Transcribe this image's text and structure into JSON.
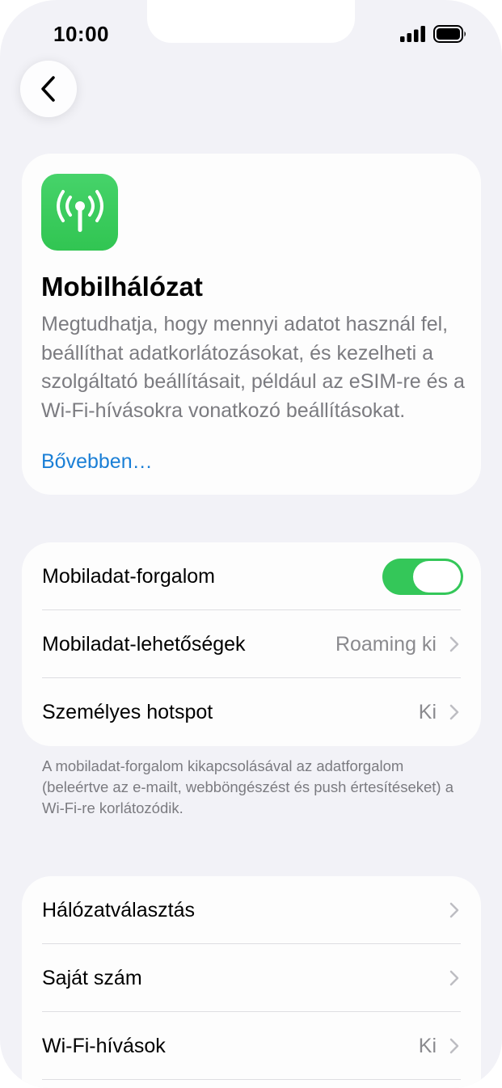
{
  "status_bar": {
    "time": "10:00",
    "signal_icon": "signal-bars-icon",
    "battery_icon": "battery-full-icon"
  },
  "nav": {
    "back_icon": "chevron-left-icon"
  },
  "intro": {
    "icon": "antenna-icon",
    "icon_color": "#34c759",
    "title": "Mobilhálózat",
    "description": "Megtudhatja, hogy mennyi adatot használ fel, beállíthat adatkorlátozásokat, és kezelheti a szolgáltató beállításait, például az eSIM-re és a Wi-Fi-hívásokra vonatkozó beállításokat.",
    "link": "Bővebben…",
    "link_color": "#1a7fd6"
  },
  "main_group": {
    "rows": [
      {
        "label": "Mobiladat-forgalom",
        "toggle_on": true
      },
      {
        "label": "Mobiladat-lehetőségek",
        "value": "Roaming ki"
      },
      {
        "label": "Személyes hotspot",
        "value": "Ki"
      }
    ],
    "footnote": "A mobiladat-forgalom kikapcsolásával az adatforgalom (beleértve az e-mailt, webböngészést és push értesítéseket) a Wi-Fi-re korlátozódik."
  },
  "network_group": {
    "rows": [
      {
        "label": "Hálózatválasztás",
        "value": ""
      },
      {
        "label": "Saját szám",
        "value": ""
      },
      {
        "label": "Wi-Fi-hívások",
        "value": "Ki"
      }
    ]
  },
  "colors": {
    "background": "#f2f2f7",
    "toggle_on": "#34c759"
  }
}
